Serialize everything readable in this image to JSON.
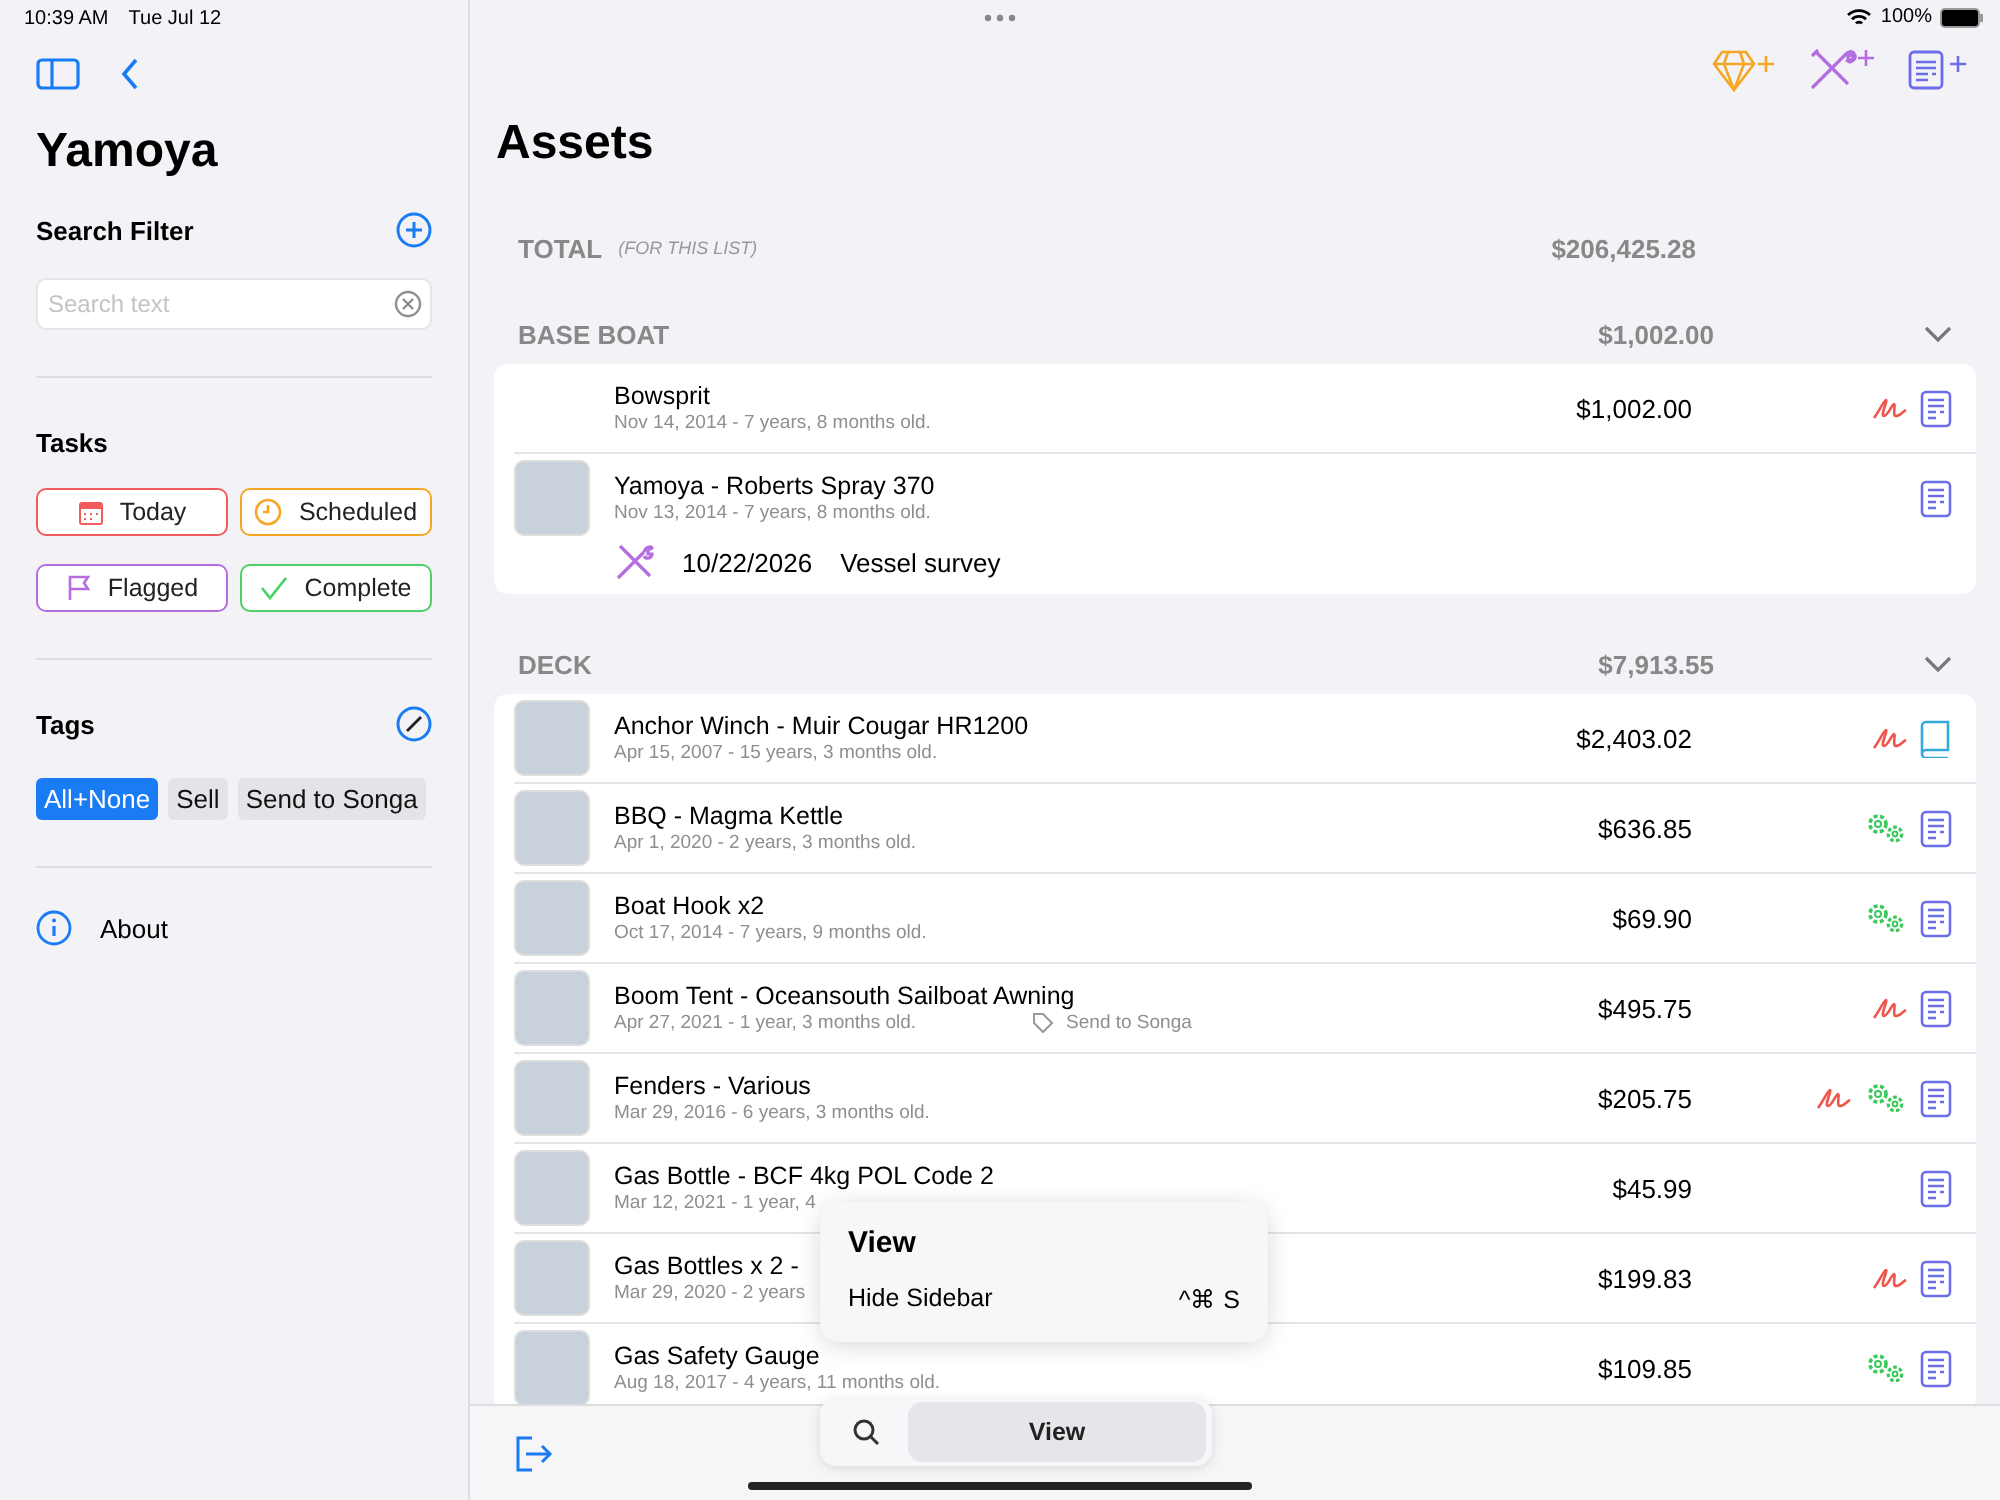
{
  "status_bar": {
    "time": "10:39 AM",
    "date": "Tue Jul 12",
    "battery": "100%"
  },
  "sidebar": {
    "title": "Yamoya",
    "search_filter": {
      "heading": "Search Filter",
      "placeholder": "Search text"
    },
    "tasks": {
      "heading": "Tasks",
      "buttons": [
        {
          "label": "Today",
          "kind": "calendar",
          "color": "#f25c5c"
        },
        {
          "label": "Scheduled",
          "kind": "clock",
          "color": "#f5a623"
        },
        {
          "label": "Flagged",
          "kind": "flag",
          "color": "#b56ee0"
        },
        {
          "label": "Complete",
          "kind": "check",
          "color": "#4cd264"
        }
      ]
    },
    "tags": {
      "heading": "Tags",
      "items": [
        {
          "label": "All+None",
          "selected": true
        },
        {
          "label": "Sell",
          "selected": false
        },
        {
          "label": "Send to Songa",
          "selected": false
        }
      ]
    },
    "about": "About"
  },
  "main": {
    "title": "Assets",
    "total": {
      "label": "TOTAL",
      "note": "(FOR THIS LIST)",
      "value": "$206,425.28"
    },
    "sections": [
      {
        "name": "BASE BOAT",
        "value": "$1,002.00",
        "rows": [
          {
            "name": "Bowsprit",
            "date": "Nov 14, 2014 - 7 years, 8 months old.",
            "price": "$1,002.00",
            "photo": false,
            "icons": [
              {
                "kind": "signature"
              },
              {
                "kind": "document"
              }
            ]
          },
          {
            "name": "Yamoya - Roberts Spray 370",
            "date": "Nov 13, 2014 - 7 years, 8 months old.",
            "photo": true,
            "icons": [
              {
                "kind": "document"
              }
            ],
            "task": {
              "date": "10/22/2026",
              "text": "Vessel survey"
            }
          }
        ]
      },
      {
        "name": "DECK",
        "value": "$7,913.55",
        "rows": [
          {
            "name": "Anchor Winch - Muir Cougar HR1200",
            "date": "Apr 15, 2007 - 15 years, 3 months old.",
            "price": "$2,403.02",
            "photo": true,
            "icons": [
              {
                "kind": "signature"
              },
              {
                "kind": "book"
              }
            ]
          },
          {
            "name": "BBQ - Magma Kettle",
            "date": "Apr 1, 2020 - 2 years, 3 months old.",
            "price": "$636.85",
            "photo": true,
            "icons": [
              {
                "kind": "gears"
              },
              {
                "kind": "document"
              }
            ]
          },
          {
            "name": "Boat Hook x2",
            "date": "Oct 17, 2014 - 7 years, 9 months old.",
            "price": "$69.90",
            "photo": true,
            "icons": [
              {
                "kind": "gears"
              },
              {
                "kind": "document"
              }
            ]
          },
          {
            "name": "Boom Tent - Oceansouth Sailboat Awning",
            "date": "Apr 27, 2021 - 1 year, 3 months old.",
            "tag": "Send to Songa",
            "price": "$495.75",
            "photo": true,
            "icons": [
              {
                "kind": "signature"
              },
              {
                "kind": "document"
              }
            ]
          },
          {
            "name": "Fenders - Various",
            "date": "Mar 29, 2016 - 6 years, 3 months old.",
            "price": "$205.75",
            "photo": true,
            "icons": [
              {
                "kind": "signature"
              },
              {
                "kind": "gears"
              },
              {
                "kind": "document"
              }
            ]
          },
          {
            "name": "Gas Bottle - BCF 4kg POL Code 2",
            "date": "Mar 12, 2021 - 1 year, 4",
            "price": "$45.99",
            "photo": true,
            "icons": [
              {
                "kind": "document"
              }
            ]
          },
          {
            "name": "Gas Bottles x 2 -",
            "date": "Mar 29, 2020 - 2 years",
            "price": "$199.83",
            "photo": true,
            "icons": [
              {
                "kind": "signature"
              },
              {
                "kind": "document"
              }
            ]
          },
          {
            "name": "Gas Safety Gauge",
            "date": "Aug 18, 2017 - 4 years, 11 months old.",
            "price": "$109.85",
            "photo": true,
            "icons": [
              {
                "kind": "gears"
              },
              {
                "kind": "document"
              }
            ]
          }
        ]
      }
    ]
  },
  "menu": {
    "title": "View",
    "items": [
      {
        "label": "Hide Sidebar",
        "shortcut": "^⌘ S"
      }
    ]
  },
  "bottom_bar": {
    "button": "View"
  }
}
